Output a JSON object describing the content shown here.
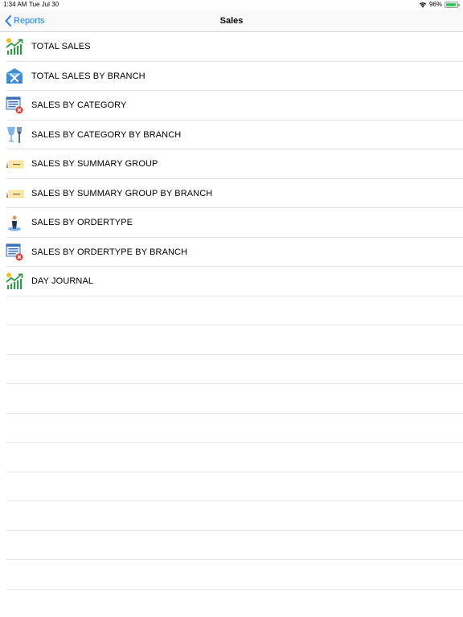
{
  "status": {
    "time": "1:34 AM",
    "date": "Tue Jul 30",
    "battery": "96%",
    "battery_level": 0.96
  },
  "nav": {
    "back_label": "Reports",
    "title": "Sales"
  },
  "reports": [
    {
      "label": "TOTAL SALES",
      "icon": "rising-chart-icon"
    },
    {
      "label": "TOTAL SALES BY BRANCH",
      "icon": "branch-envelope-icon"
    },
    {
      "label": "SALES BY CATEGORY",
      "icon": "category-list-icon"
    },
    {
      "label": "SALES BY CATEGORY BY BRANCH",
      "icon": "glass-fork-icon"
    },
    {
      "label": "SALES BY SUMMARY GROUP",
      "icon": "summary-card-icon"
    },
    {
      "label": "SALES BY SUMMARY GROUP BY BRANCH",
      "icon": "summary-card-icon"
    },
    {
      "label": "SALES BY ORDERTYPE",
      "icon": "person-marker-icon"
    },
    {
      "label": "SALES BY ORDERTYPE BY BRANCH",
      "icon": "category-list-icon"
    },
    {
      "label": "DAY JOURNAL",
      "icon": "rising-chart-icon"
    }
  ],
  "colors": {
    "accent": "#1e7cf2",
    "chart_green": "#2e9b45",
    "coin_yellow": "#f2c21b",
    "envelope_blue": "#3f8fd8",
    "alert_red": "#e53935"
  }
}
